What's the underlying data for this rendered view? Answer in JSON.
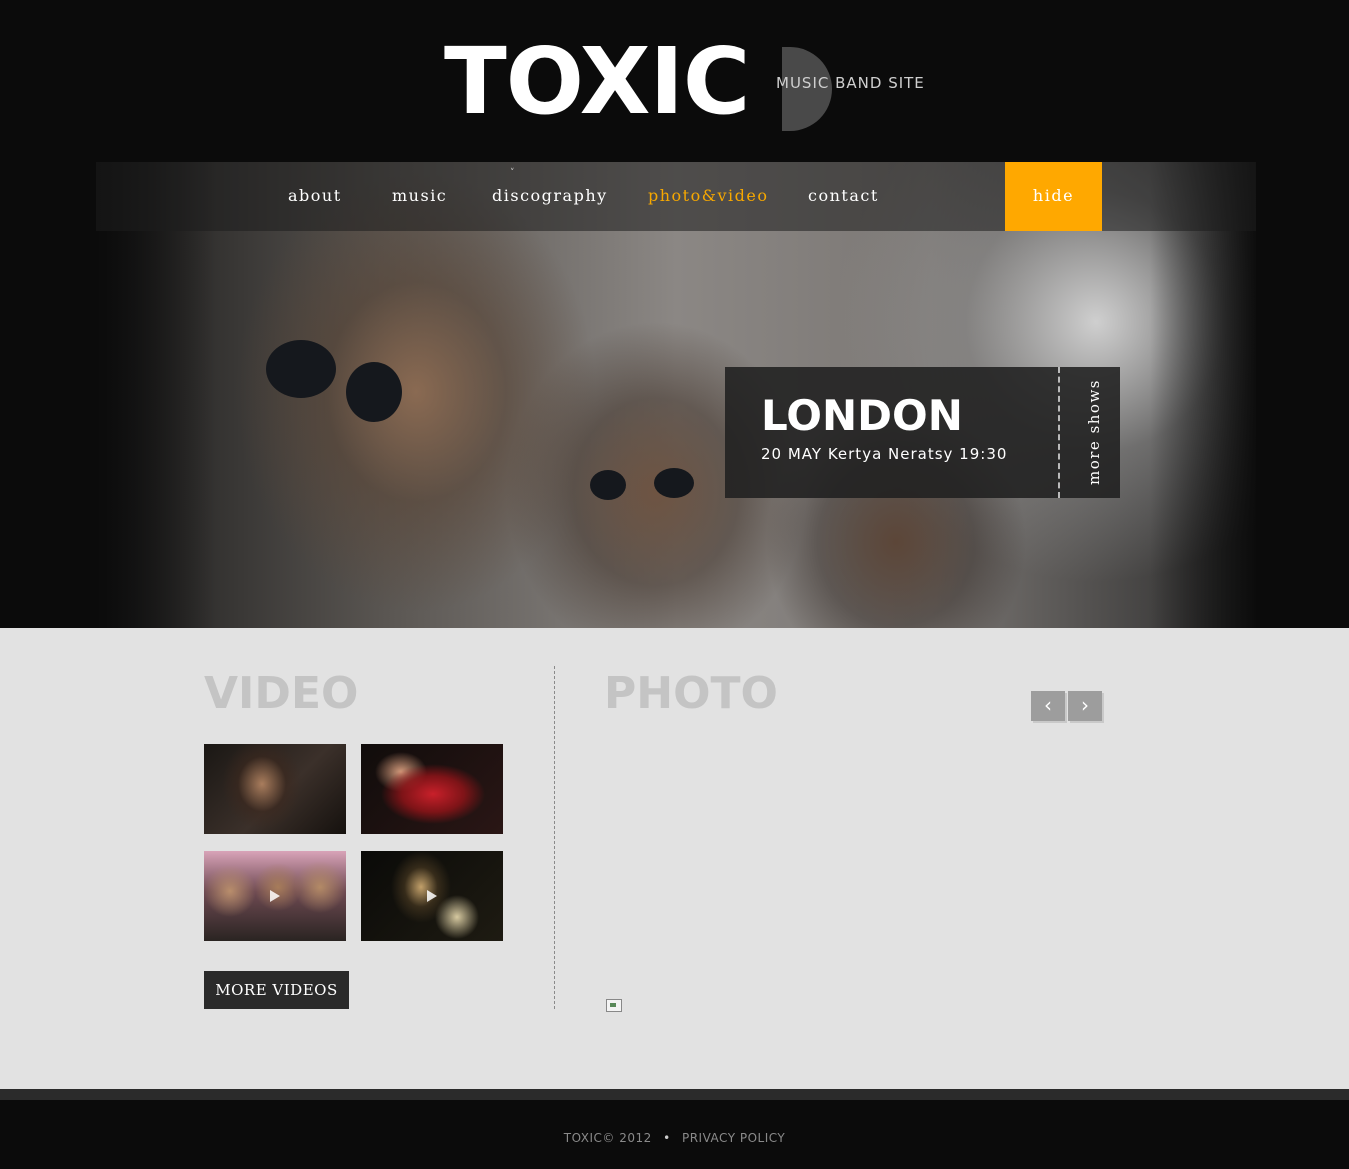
{
  "brand": {
    "logo": "TOXIC",
    "tagline": "MUSIC BAND SITE"
  },
  "nav": {
    "items": [
      {
        "label": "about"
      },
      {
        "label": "music"
      },
      {
        "label": "discography"
      },
      {
        "label": "photo&video"
      },
      {
        "label": "contact"
      }
    ],
    "hide_label": "hide",
    "active_color": "#f7a800",
    "hide_color": "#ffa800"
  },
  "show": {
    "city": "LONDON",
    "details": "20 MAY Kertya Neratsy 19:30",
    "more_label": "more shows"
  },
  "video": {
    "title": "VIDEO",
    "more_label": "MORE VIDEOS"
  },
  "photo": {
    "title": "PHOTO",
    "prev_icon": "‹",
    "next_icon": "›"
  },
  "footer": {
    "copyright": "TOXIC© 2012",
    "separator": "•",
    "privacy": "PRIVACY POLICY"
  }
}
